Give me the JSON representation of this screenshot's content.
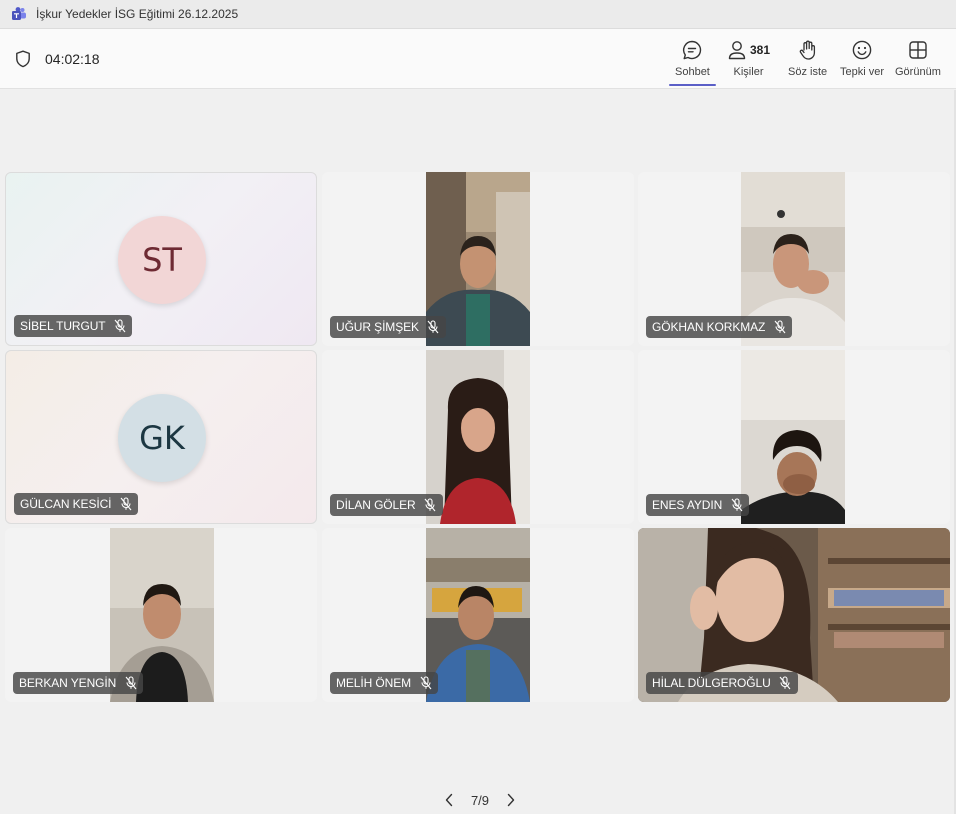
{
  "window": {
    "title": "İşkur Yedekler İSG Eğitimi 26.12.2025",
    "app_icon": "teams-icon"
  },
  "toolbar": {
    "timer": "04:02:18",
    "buttons": {
      "chat": {
        "label": "Sohbet",
        "icon": "chat-icon",
        "active": true
      },
      "people": {
        "label": "Kişiler",
        "icon": "people-icon",
        "count": "381"
      },
      "raise": {
        "label": "Söz iste",
        "icon": "raise-hand-icon"
      },
      "react": {
        "label": "Tepki ver",
        "icon": "smiley-icon"
      },
      "view": {
        "label": "Görünüm",
        "icon": "grid-view-icon"
      }
    },
    "accent": "#5b5fc7"
  },
  "tiles": [
    {
      "name": "SİBEL TURGUT",
      "initials": "ST",
      "muted": true
    },
    {
      "name": "UĞUR ŞİMŞEK",
      "muted": true
    },
    {
      "name": "GÖKHAN KORKMAZ",
      "muted": true
    },
    {
      "name": "GÜLCAN KESİCİ",
      "initials": "GK",
      "muted": true
    },
    {
      "name": "DİLAN GÖLER",
      "muted": true
    },
    {
      "name": "ENES AYDIN",
      "muted": true
    },
    {
      "name": "BERKAN YENGİN",
      "muted": true
    },
    {
      "name": "MELİH ÖNEM",
      "muted": true
    },
    {
      "name": "HİLAL DÜLGEROĞLU",
      "muted": true
    }
  ],
  "pager": {
    "text": "7/9"
  }
}
